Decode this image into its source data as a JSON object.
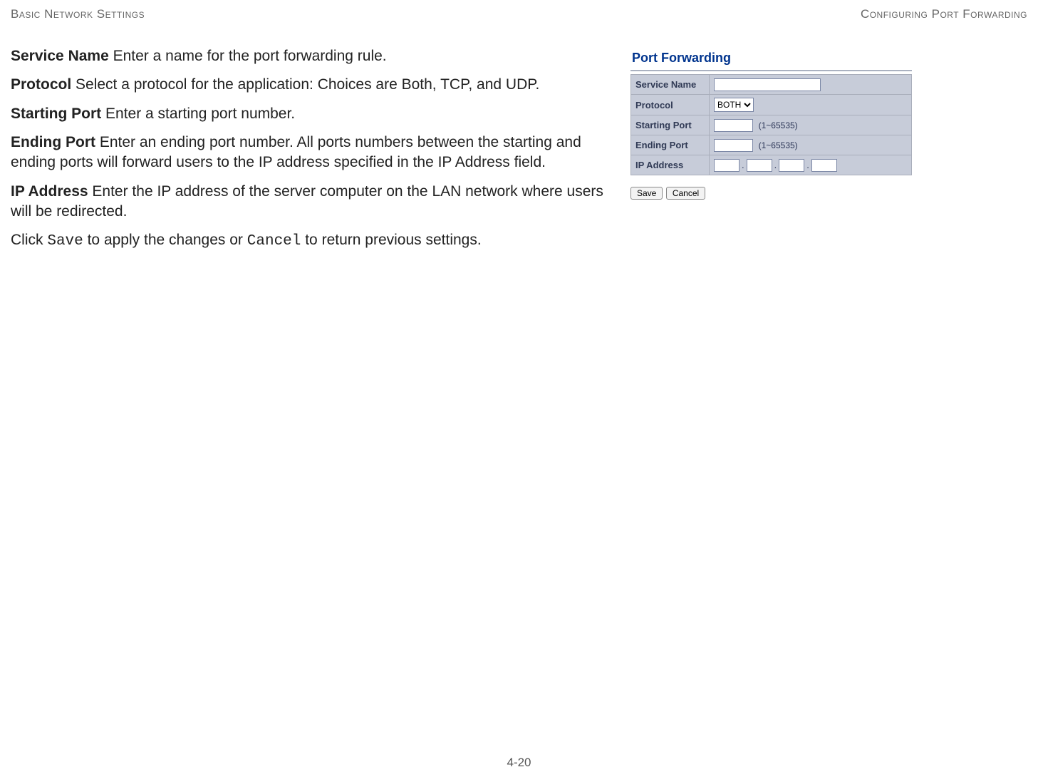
{
  "header": {
    "left": "Basic Network Settings",
    "right": "Configuring Port Forwarding"
  },
  "doc": {
    "service_name_term": "Service Name",
    "service_name_desc": "  Enter a name for the port forwarding rule.",
    "protocol_term": "Protocol",
    "protocol_desc": "  Select a protocol for the application: Choices are Both, TCP, and UDP.",
    "starting_port_term": "Starting Port",
    "starting_port_desc": "  Enter a starting port number.",
    "ending_port_term": "Ending Port",
    "ending_port_desc": "  Enter an ending port number. All ports numbers between the starting and ending ports will forward users to the IP address specified in the IP Address field.",
    "ip_address_term": "IP Address",
    "ip_address_desc": "  Enter the IP address of the server computer on the LAN network where users will be redirected.",
    "action_prefix": "Click ",
    "save_code": "Save",
    "action_mid": " to apply the changes or ",
    "cancel_code": "Cancel",
    "action_suffix": " to return previous settings."
  },
  "panel": {
    "title": "Port Forwarding",
    "rows": {
      "service_name": "Service Name",
      "protocol": "Protocol",
      "starting_port": "Starting Port",
      "ending_port": "Ending Port",
      "ip_address": "IP Address"
    },
    "protocol_value": "BOTH",
    "port_hint": "(1~65535)",
    "buttons": {
      "save": "Save",
      "cancel": "Cancel"
    }
  },
  "page_number": "4-20"
}
